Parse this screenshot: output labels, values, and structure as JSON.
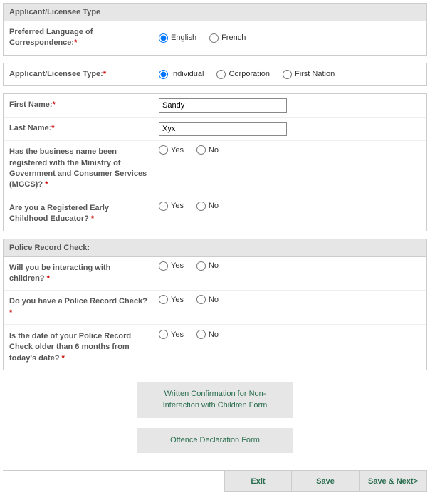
{
  "section1": {
    "header": "Applicant/Licensee Type",
    "lang_label": "Preferred Language of Correspondence:",
    "lang_opts": {
      "en": "English",
      "fr": "French"
    },
    "type_label": "Applicant/Licensee Type:",
    "type_opts": {
      "ind": "Individual",
      "corp": "Corporation",
      "fn": "First Nation"
    },
    "first_name_label": "First Name:",
    "first_name_value": "Sandy",
    "last_name_label": "Last Name:",
    "last_name_value": "Xyx",
    "mgcs_label": "Has the business name been registered with the Ministry of Government and Consumer Services (MGCS)? ",
    "rece_label": "Are you a Registered Early Childhood Educator? ",
    "yes": "Yes",
    "no": "No"
  },
  "section2": {
    "header": "Police Record Check:",
    "interact_label": "Will you be interacting with children? ",
    "prc_label": "Do you have a Police Record Check? ",
    "prc_date_label": "Is the date of your Police Record Check older than 6 months from today's date? ",
    "yes": "Yes",
    "no": "No"
  },
  "form_buttons": {
    "noninteraction": "Written Confirmation for Non-Interaction with Children Form",
    "offence": "Offence Declaration Form"
  },
  "actions": {
    "exit": "Exit",
    "save": "Save",
    "save_next": "Save & Next>"
  },
  "req": "*"
}
